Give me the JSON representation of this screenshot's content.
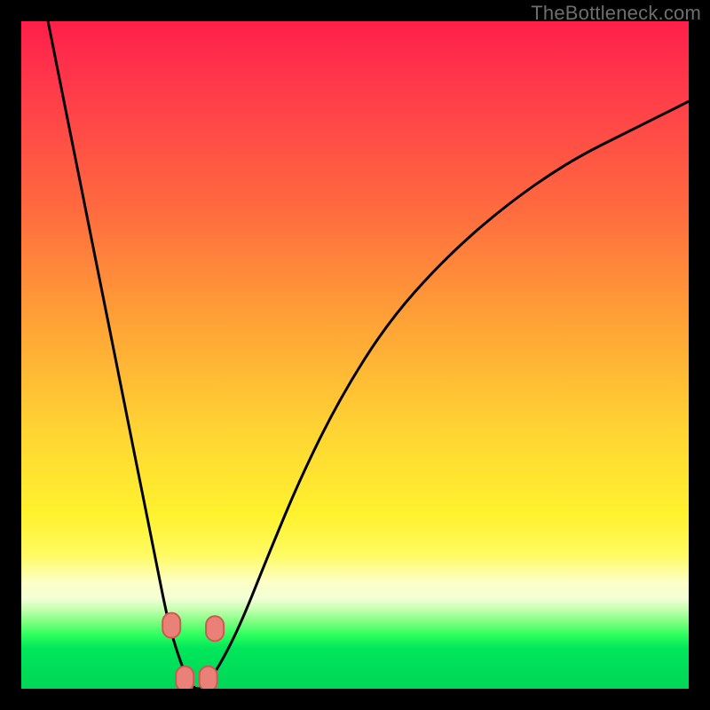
{
  "watermark": "TheBottleneck.com",
  "chart_data": {
    "type": "line",
    "title": "",
    "xlabel": "",
    "ylabel": "",
    "xlim": [
      0,
      100
    ],
    "ylim": [
      0,
      100
    ],
    "grid": false,
    "legend": false,
    "series": [
      {
        "name": "bottleneck-curve",
        "x": [
          4,
          6,
          8,
          10,
          12,
          14,
          16,
          18,
          20,
          22,
          23.5,
          25,
          26,
          27,
          28,
          30,
          33,
          37,
          42,
          48,
          55,
          63,
          72,
          82,
          92,
          100
        ],
        "y": [
          100,
          90,
          80,
          70,
          60,
          50,
          40,
          30,
          20,
          10,
          5,
          1,
          0,
          0,
          1,
          4,
          10,
          20,
          32,
          44,
          55,
          64,
          72,
          79,
          84,
          88
        ]
      }
    ],
    "markers": [
      {
        "name": "trough-marker-left-upper",
        "x": 22.5,
        "y": 9.5
      },
      {
        "name": "trough-marker-right-upper",
        "x": 29.0,
        "y": 9.0
      },
      {
        "name": "trough-marker-left-lower",
        "x": 24.5,
        "y": 1.5
      },
      {
        "name": "trough-marker-right-lower",
        "x": 28.0,
        "y": 1.5
      }
    ],
    "background_bands_comment": "vertical gradient red→orange→yellow→pale→green, encoded in CSS",
    "curve_stroke": "#000000",
    "marker_fill": "#e98178",
    "marker_stroke": "#cc5a52"
  }
}
